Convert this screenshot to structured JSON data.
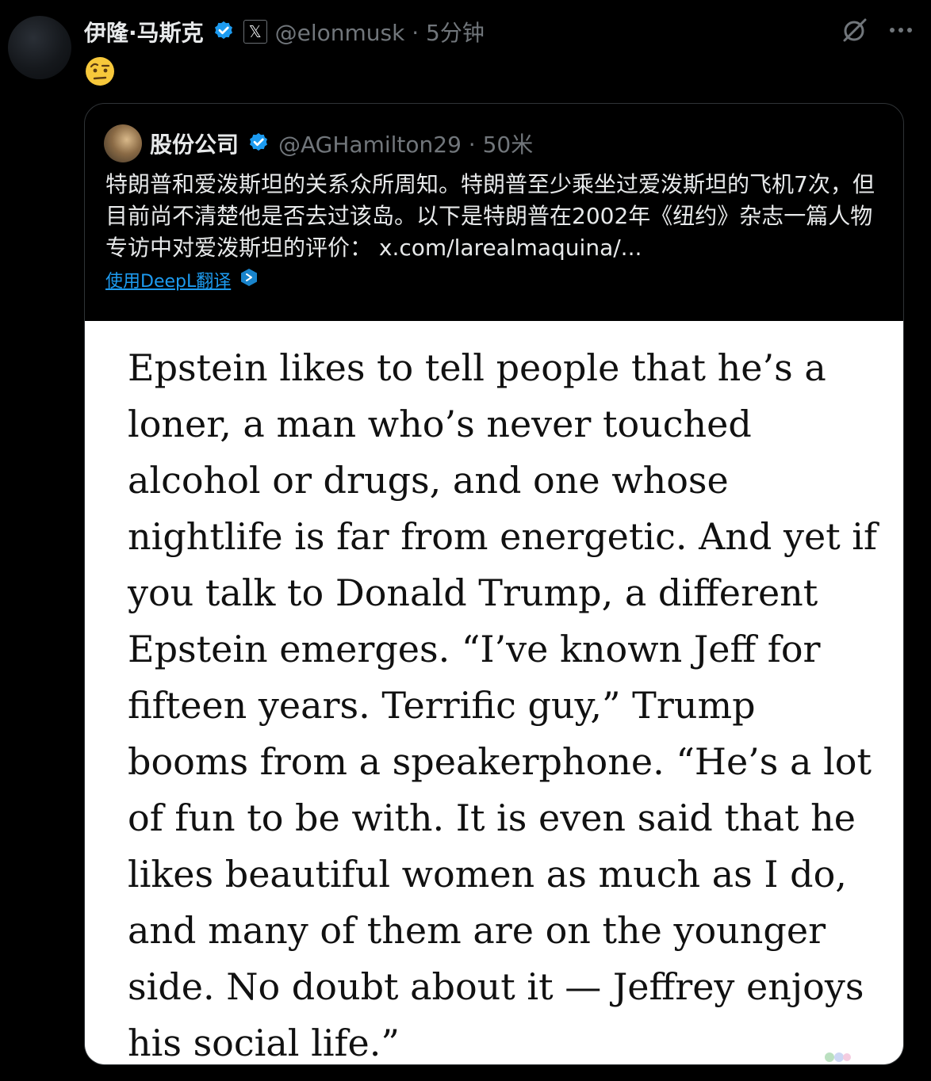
{
  "post": {
    "author_name": "伊隆·马斯克",
    "handle_time": "@elonmusk · 5分钟",
    "x_badge": "𝕏",
    "emoji": "🤨"
  },
  "icons": {
    "verified": "verified-badge-icon",
    "grok": "grok-icon",
    "more": "more-options-icon",
    "deepl": "deepl-icon"
  },
  "quote": {
    "author_name": "股份公司",
    "handle_time": "@AGHamilton29 · 50米",
    "text": "特朗普和爱泼斯坦的关系众所周知。特朗普至少乘坐过爱泼斯坦的飞机7次，但目前尚不清楚他是否去过该岛。以下是特朗普在2002年《纽约》杂志一篇人物专访中对爱泼斯坦的评价： x.com/larealmaquina/...",
    "translate_label": "使用DeepL翻译",
    "media_text": "Epstein likes to tell people that he’s a loner, a man who’s never touched alcohol or drugs, and one whose nightlife is far from energetic. And yet if you talk to Donald Trump, a different Epstein emerges. “I’ve known Jeff for fifteen years. Terrific guy,” Trump booms from a speakerphone. “He’s a lot of fun to be with. It is even said that he likes beautiful women as much as I do, and many of them are on the younger side. No doubt about it — Jeffrey enjoys his social life.”"
  },
  "colors": {
    "background": "#000000",
    "text": "#e7e9ea",
    "muted": "#71767b",
    "accent": "#1d9bf0",
    "border": "#2f3336"
  }
}
